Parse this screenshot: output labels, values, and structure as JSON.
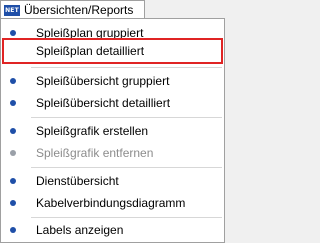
{
  "app_icon": {
    "text": "NET"
  },
  "menubar": {
    "menu_label": "Übersichten/Reports"
  },
  "menu": {
    "items": [
      {
        "label": "Spleißplan gruppiert",
        "enabled": true,
        "icon": "bullet-icon"
      },
      {
        "label": "Spleißplan detailliert",
        "enabled": true,
        "icon": "bullet-icon",
        "highlighted": true
      },
      {
        "label": "Spleißübersicht gruppiert",
        "enabled": true,
        "icon": "bullet-icon"
      },
      {
        "label": "Spleißübersicht detailliert",
        "enabled": true,
        "icon": "bullet-icon"
      },
      {
        "label": "Spleißgrafik erstellen",
        "enabled": true,
        "icon": "bullet-icon"
      },
      {
        "label": "Spleißgrafik entfernen",
        "enabled": false,
        "icon": "bullet-icon"
      },
      {
        "label": "Dienstübersicht",
        "enabled": true,
        "icon": "bullet-icon"
      },
      {
        "label": "Kabelverbindungsdiagramm",
        "enabled": true,
        "icon": "bullet-icon"
      },
      {
        "label": "Labels anzeigen",
        "enabled": true,
        "icon": "bullet-icon"
      }
    ]
  },
  "colors": {
    "accent": "#1f4fa8",
    "highlight_border": "#e02424",
    "disabled_text": "#8c8c8c"
  }
}
